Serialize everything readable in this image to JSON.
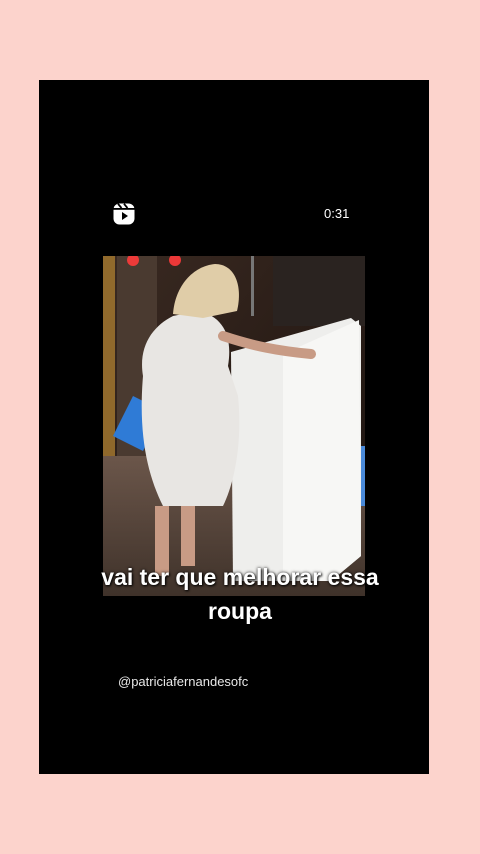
{
  "story": {
    "duration": "0:31",
    "caption_line1": "vai ter que melhorar essa",
    "caption_line2": "roupa",
    "handle": "@patriciafernandesofc"
  },
  "icons": {
    "reels": "reels-icon"
  },
  "colors": {
    "page_background": "#fcd3cc",
    "card_background": "#000000",
    "text": "#ffffff"
  }
}
